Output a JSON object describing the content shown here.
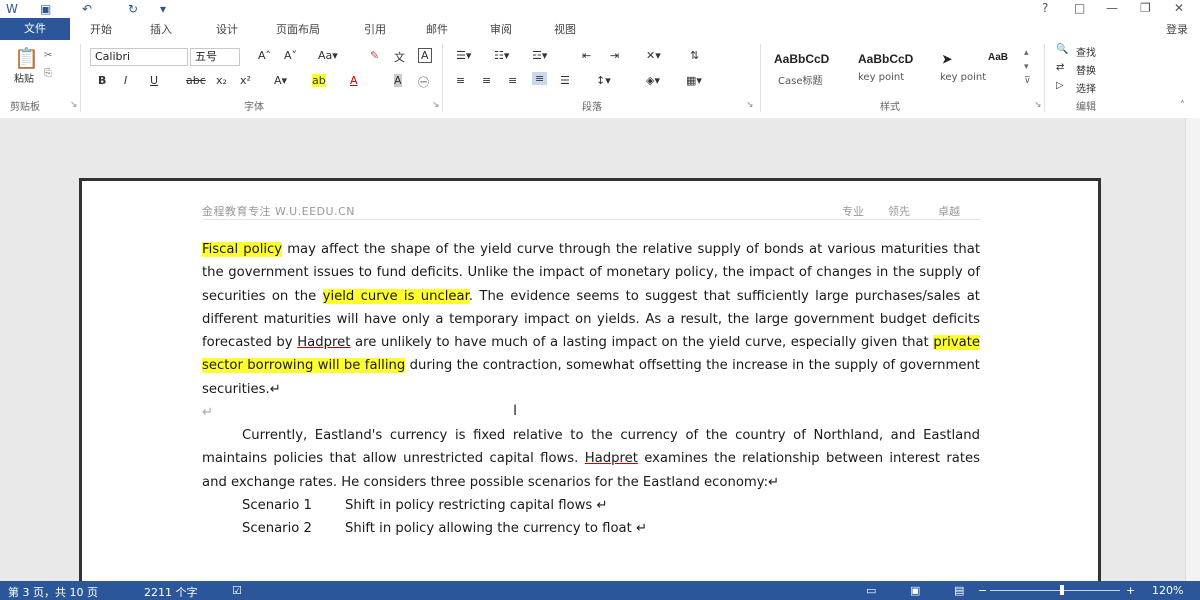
{
  "titlebar": {
    "quick_icons": [
      "word-logo-icon",
      "save-icon",
      "undo-icon",
      "redo-icon",
      "customize-icon"
    ],
    "controls": [
      "?",
      "□",
      "—",
      "❐",
      "✕"
    ]
  },
  "ribbon_tabs": [
    "文件",
    "开始",
    "插入",
    "设计",
    "页面布局",
    "引用",
    "邮件",
    "审阅",
    "视图"
  ],
  "login": "登录",
  "ribbon": {
    "clipboard_label": "剪贴板",
    "paste_label": "粘贴",
    "font_label": "字体",
    "font_name": "Calibri",
    "font_size": "五号",
    "paragraph_label": "段落",
    "styles_label": "样式",
    "editing_label": "编辑",
    "styles": [
      {
        "preview": "AaBbCcD",
        "name": "Case标题"
      },
      {
        "preview": "AaBbCcD",
        "name": "key point"
      },
      {
        "preview": "➤",
        "name": "key point"
      },
      {
        "preview": "AaB",
        "name": ""
      }
    ],
    "editing": [
      "查找",
      "替换",
      "选择"
    ]
  },
  "document": {
    "header_left": "金程教育专注 W.U.EEDU.CN",
    "header_right": [
      "专业",
      "领先",
      "卓越"
    ],
    "p1": {
      "hl1": "Fiscal policy",
      "t1": " may affect the shape of the yield curve through the relative supply of bonds at various maturities that the government issues to fund deficits. Unlike the impact of monetary policy, the impact of changes in the supply of securities on the ",
      "hl2": "yield curve is unclear",
      "t2": ". The evidence seems to suggest that sufficiently large purchases/sales at different maturities will have only a temporary impact on yields. As a result, the large government budget deficits forecasted by ",
      "name": "Hadpret",
      "t3": " are unlikely to have much of a lasting impact on the yield curve, especially given that ",
      "hl3": "private sector borrowing will be falling",
      "t4": " during the contraction, somewhat offsetting the increase in the supply of government securities.↵"
    },
    "p2": {
      "t1": "Currently, Eastland's currency is fixed relative to the currency of the country of Northland, and Eastland maintains policies that allow unrestricted capital flows. ",
      "name": "Hadpret",
      "t2": " examines the relationship between interest rates and exchange rates. He considers three possible scenarios for the Eastland economy:↵"
    },
    "scenarios": [
      {
        "label": "Scenario 1",
        "text": "Shift in policy restricting capital flows ↵"
      },
      {
        "label": "Scenario 2",
        "text": "Shift in policy allowing the currency to float ↵"
      }
    ]
  },
  "status": {
    "page": "第 3 页，共 10 页",
    "words": "2211 个字",
    "zoom": "120%"
  },
  "colors": {
    "accent": "#2b579a",
    "highlight": "#ffff2e"
  }
}
